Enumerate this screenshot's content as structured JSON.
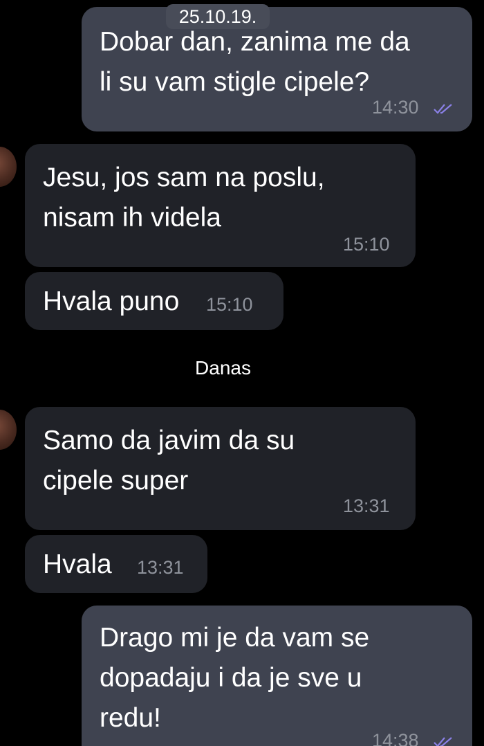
{
  "chat": {
    "date_old": "25.10.19.",
    "date_today": "Danas",
    "messages": [
      {
        "text": "Dobar dan, zanima me da\nli su vam stigle cipele?",
        "time": "14:30",
        "status": "read"
      },
      {
        "text": "Jesu, jos sam na poslu,\nnisam ih videla",
        "time": "15:10"
      },
      {
        "text": "Hvala puno",
        "time": "15:10"
      },
      {
        "text": "Samo da javim da su\ncipele super",
        "time": "13:31"
      },
      {
        "text": "Hvala",
        "time": "13:31"
      },
      {
        "text": "Drago mi je da vam se\ndopadaju i da je sve u\nredu!",
        "time": "14:38",
        "status": "read"
      }
    ]
  },
  "colors": {
    "background": "#000000",
    "outgoing_bubble": "#3f4350",
    "incoming_bubble": "#202228",
    "read_check": "#8a80e6",
    "timestamp": "#8f939c"
  },
  "icons": {
    "read_receipt": "double-check-icon",
    "avatar": "contact-avatar"
  }
}
